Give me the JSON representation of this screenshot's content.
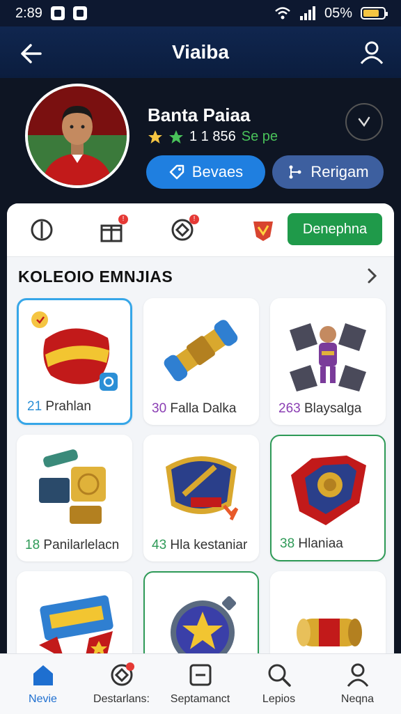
{
  "status_bar": {
    "time": "2:89",
    "battery": "05%"
  },
  "app_bar": {
    "title": "Viaiba"
  },
  "profile": {
    "name": "Banta Paiaa",
    "rating": "1 1 856",
    "rating_sub": "Se pe",
    "primary_button": "Bevaes",
    "secondary_button": "Rerigam"
  },
  "actions": {
    "green_button": "Denephna"
  },
  "collection": {
    "title": "KOLEOIO EMNJIAS",
    "items": [
      {
        "number": "21",
        "name": "Prahlan"
      },
      {
        "number": "30",
        "name": "Falla Dalka"
      },
      {
        "number": "263",
        "name": "Blaysalga"
      },
      {
        "number": "18",
        "name": "Panilarlelacn"
      },
      {
        "number": "43",
        "name": "Hla kestaniar"
      },
      {
        "number": "38",
        "name": "Hlaniaa"
      },
      {
        "number": "",
        "name": ""
      },
      {
        "number": "",
        "name": ""
      },
      {
        "number": "",
        "name": ""
      }
    ]
  },
  "bottom_nav": [
    {
      "label": "Nevie",
      "icon": "home-icon"
    },
    {
      "label": "Destarlans:",
      "icon": "target-icon"
    },
    {
      "label": "Septamanct",
      "icon": "minus-box-icon"
    },
    {
      "label": "Lepios",
      "icon": "search-icon"
    },
    {
      "label": "Neqna",
      "icon": "user-icon"
    }
  ],
  "colors": {
    "primary": "#1f7fe0",
    "green": "#1f9a4a",
    "appbar": "#10264f"
  }
}
